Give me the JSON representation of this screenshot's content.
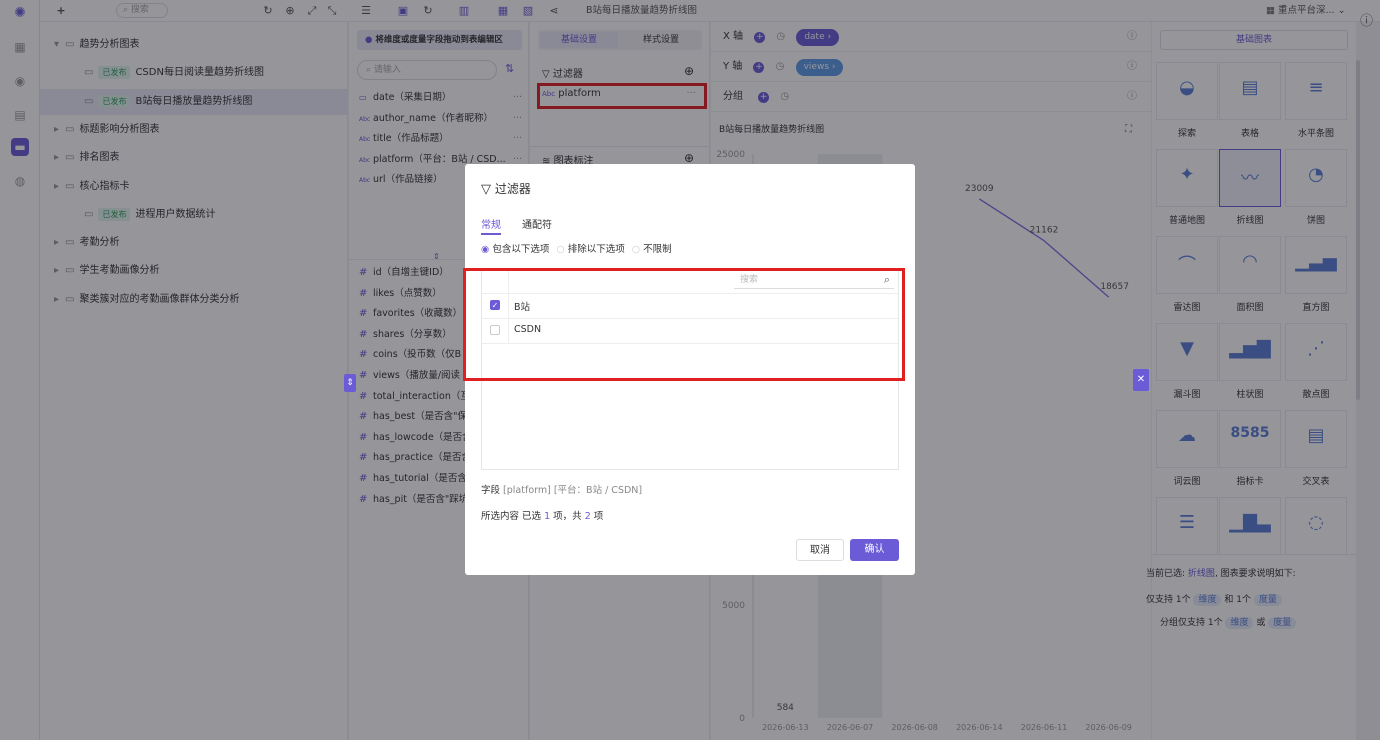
{
  "topbar": {
    "search_placeholder": "搜索",
    "chart_title": "B站每日播放量趋势折线图",
    "platform": "重点平台深..."
  },
  "tree": [
    {
      "label": "趋势分析图表",
      "kind": "folder",
      "open": true
    },
    {
      "label": "CSDN每日阅读量趋势折线图",
      "kind": "chart",
      "badge": "已发布"
    },
    {
      "label": "B站每日播放量趋势折线图",
      "kind": "chart",
      "badge": "已发布",
      "selected": true
    },
    {
      "label": "标题影响分析图表",
      "kind": "folder"
    },
    {
      "label": "排名图表",
      "kind": "folder"
    },
    {
      "label": "核心指标卡",
      "kind": "folder"
    },
    {
      "label": "进程用户数据统计",
      "kind": "chart",
      "badge": "已发布"
    },
    {
      "label": "考勤分析",
      "kind": "folder"
    },
    {
      "label": "学生考勤画像分析",
      "kind": "folder"
    },
    {
      "label": "聚类簇对应的考勤画像群体分类分析",
      "kind": "folder"
    }
  ],
  "fields": {
    "hint": "将维度或度量字段拖动到表编辑区",
    "search_placeholder": "请输入",
    "dimensions": [
      {
        "type": "date",
        "label": "date（采集日期）"
      },
      {
        "type": "Abc",
        "label": "author_name（作者昵称）"
      },
      {
        "type": "Abc",
        "label": "title（作品标题）"
      },
      {
        "type": "Abc",
        "label": "platform（平台：B站 / CSD..."
      },
      {
        "type": "Abc",
        "label": "url（作品链接）"
      }
    ],
    "measures": [
      {
        "label": "id（自增主键ID）"
      },
      {
        "label": "likes（点赞数）"
      },
      {
        "label": "favorites（收藏数）"
      },
      {
        "label": "shares（分享数）"
      },
      {
        "label": "coins（投币数（仅B"
      },
      {
        "label": "views（播放量/阅读"
      },
      {
        "label": "total_interaction（互"
      },
      {
        "label": "has_best（是否含\"保"
      },
      {
        "label": "has_lowcode（是否含"
      },
      {
        "label": "has_practice（是否含"
      },
      {
        "label": "has_tutorial（是否含\""
      },
      {
        "label": "has_pit（是否含\"踩坑"
      }
    ]
  },
  "config": {
    "tab_basic": "基础设置",
    "tab_style": "样式设置",
    "filter_label": "过滤器",
    "filter_item": "platform",
    "mark_label": "图表标注"
  },
  "axes": {
    "x_label": "X 轴",
    "x_field": "date",
    "y_label": "Y 轴",
    "y_field": "views",
    "group_label": "分组",
    "chart_title": "B站每日播放量趋势折线图"
  },
  "chart_data": {
    "type": "line",
    "x": [
      "2026-06-13",
      "2026-06-07",
      "2026-06-08",
      "2026-06-14",
      "2026-06-11",
      "2026-06-09"
    ],
    "y_ticks": [
      0,
      5000,
      25000
    ],
    "values": [
      null,
      null,
      null,
      23009,
      21162,
      18657
    ],
    "visible_labels": [
      {
        "text": "23009",
        "value": 23009
      },
      {
        "text": "21162",
        "value": 21162
      },
      {
        "text": "18657",
        "value": 18657
      },
      {
        "text": "584",
        "value": null
      }
    ],
    "ylim": [
      0,
      25000
    ]
  },
  "right": {
    "header": "基础图表",
    "types": [
      "探索",
      "表格",
      "水平条图",
      "普通地图",
      "折线图",
      "饼图",
      "雷达图",
      "面积图",
      "直方图",
      "漏斗图",
      "柱状图",
      "散点图",
      "词云图",
      "指标卡",
      "交叉表"
    ],
    "selected": "折线图",
    "card_text": "8585",
    "desc_prefix": "当前已选:",
    "desc_chart": "折线图",
    "desc_suffix": ", 图表要求说明如下:",
    "rule1_a": "仅支持 1个",
    "rule1_dim": "维度",
    "rule1_b": "和 1个",
    "rule1_mea": "度量",
    "rule2_a": "分组仅支持 1个",
    "rule2_dim": "维度",
    "rule2_b": "或",
    "rule2_mea": "度量"
  },
  "dialog": {
    "title": "过滤器",
    "tab_normal": "常规",
    "tab_wildcard": "通配符",
    "radio_include": "包含以下选项",
    "radio_exclude": "排除以下选项",
    "radio_unlimited": "不限制",
    "search_placeholder": "搜索",
    "options": [
      {
        "label": "B站",
        "checked": true
      },
      {
        "label": "CSDN",
        "checked": false
      }
    ],
    "field_label": "字段",
    "field_value": "[platform] [平台：B站 / CSDN]",
    "selected_prefix": "所选内容 已选",
    "selected_count": "1",
    "selected_mid": "项，共",
    "total_count": "2",
    "selected_suffix": "项",
    "cancel": "取消",
    "confirm": "确认"
  },
  "colors": {
    "accent": "#6b5bd6",
    "highlight": "#e02020",
    "published": "#2e9e60"
  }
}
